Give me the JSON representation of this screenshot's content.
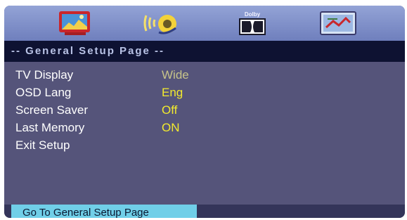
{
  "header": {
    "page_title": "-- General Setup Page --"
  },
  "icons": [
    {
      "name": "general-setup-icon"
    },
    {
      "name": "audio-setup-icon"
    },
    {
      "name": "dolby-setup-icon"
    },
    {
      "name": "video-setup-icon"
    }
  ],
  "dolby_label": "Dolby",
  "menu": {
    "items": [
      {
        "label": "TV Display",
        "value": "Wide"
      },
      {
        "label": "OSD Lang",
        "value": "Eng"
      },
      {
        "label": "Screen Saver",
        "value": "Off"
      },
      {
        "label": "Last Memory",
        "value": "ON"
      },
      {
        "label": "Exit Setup",
        "value": ""
      }
    ]
  },
  "status": {
    "text": "Go To General Setup Page"
  }
}
